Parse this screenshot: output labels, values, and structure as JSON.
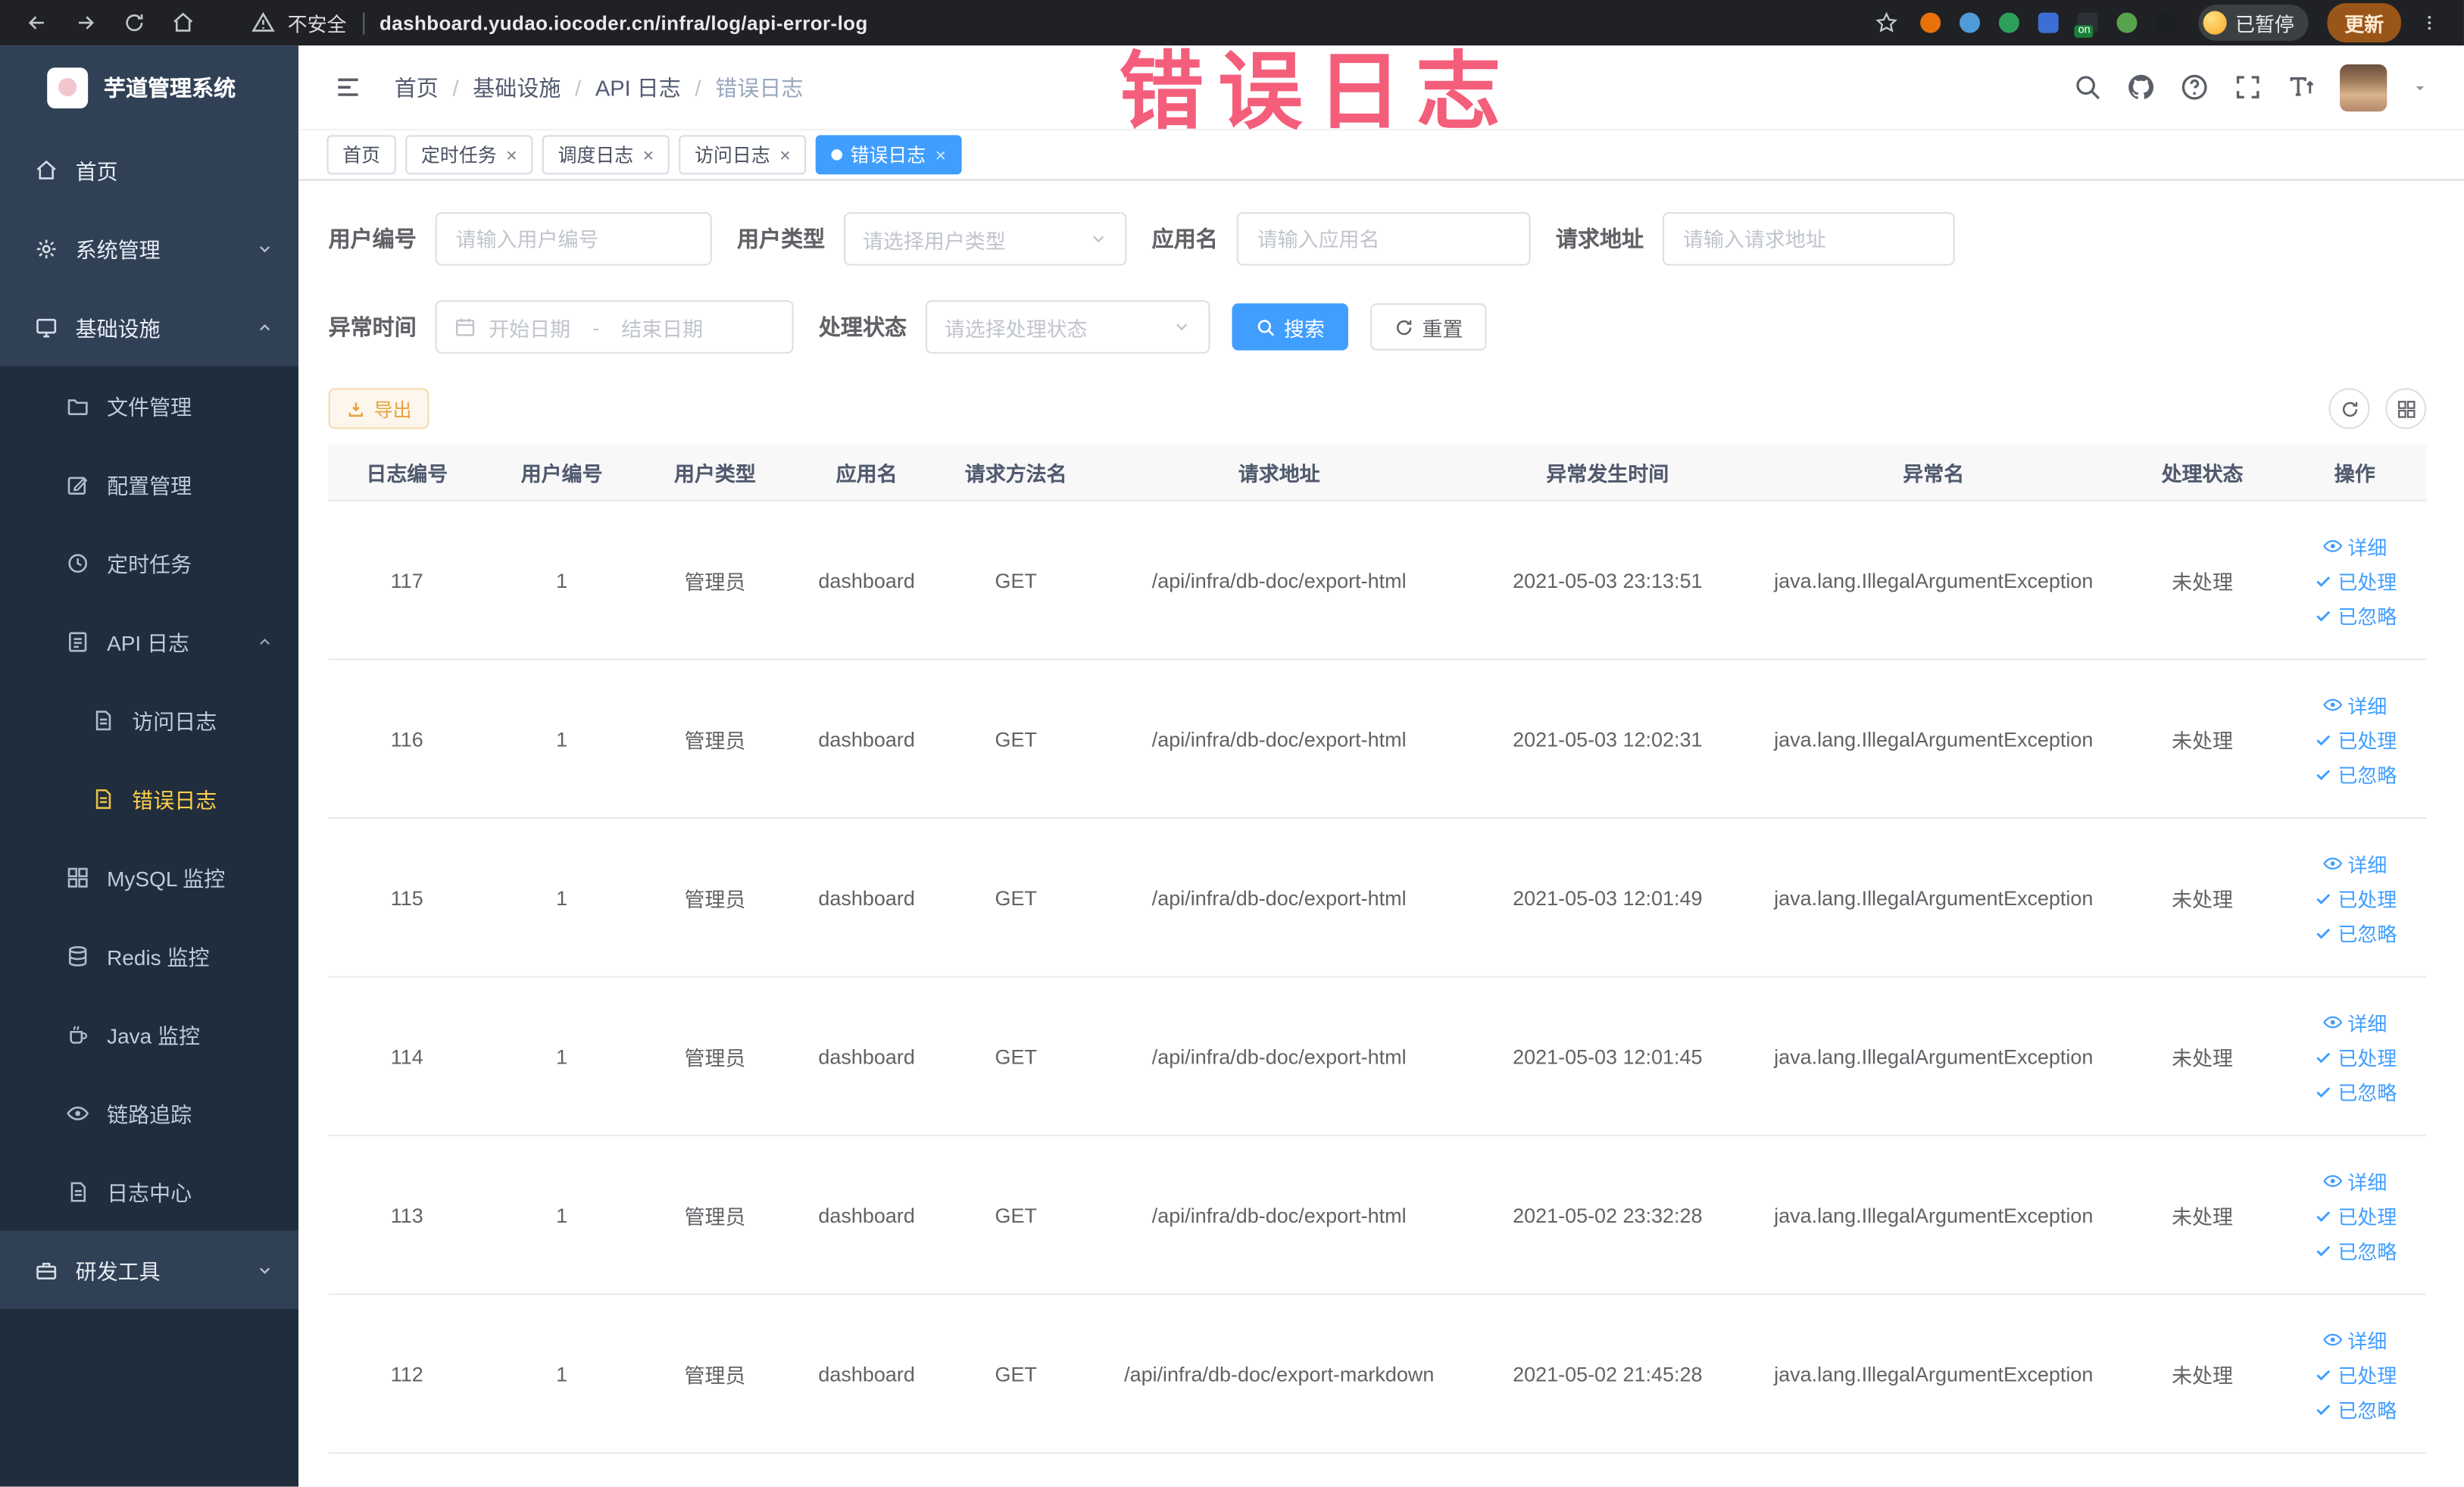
{
  "browser": {
    "security_label": "不安全",
    "url": "dashboard.yudao.iocoder.cn/infra/log/api-error-log",
    "profile_badge": "已暂停",
    "update_button": "更新",
    "extension_badge": "on"
  },
  "watermark": "错误日志",
  "sidebar": {
    "logo_title": "芋道管理系统",
    "home": "首页",
    "system": "系统管理",
    "infra": "基础设施",
    "file": "文件管理",
    "config": "配置管理",
    "job": "定时任务",
    "api_log": "API 日志",
    "access_log": "访问日志",
    "error_log": "错误日志",
    "mysql": "MySQL 监控",
    "redis": "Redis 监控",
    "java": "Java 监控",
    "trace": "链路追踪",
    "log_center": "日志中心",
    "dev_tools": "研发工具"
  },
  "breadcrumb": {
    "separator": "/",
    "items": [
      "首页",
      "基础设施",
      "API 日志",
      "错误日志"
    ]
  },
  "tabs": [
    {
      "label": "首页",
      "closable": false,
      "active": false
    },
    {
      "label": "定时任务",
      "closable": true,
      "active": false
    },
    {
      "label": "调度日志",
      "closable": true,
      "active": false
    },
    {
      "label": "访问日志",
      "closable": true,
      "active": false
    },
    {
      "label": "错误日志",
      "closable": true,
      "active": true
    }
  ],
  "filters": {
    "user_no": {
      "label": "用户编号",
      "placeholder": "请输入用户编号"
    },
    "user_type": {
      "label": "用户类型",
      "placeholder": "请选择用户类型"
    },
    "app_name": {
      "label": "应用名",
      "placeholder": "请输入应用名"
    },
    "req_url": {
      "label": "请求地址",
      "placeholder": "请输入请求地址"
    },
    "exc_time": {
      "label": "异常时间",
      "start": "开始日期",
      "sep": "-",
      "end": "结束日期"
    },
    "status": {
      "label": "处理状态",
      "placeholder": "请选择处理状态"
    },
    "search": "搜索",
    "reset": "重置"
  },
  "toolbar": {
    "export": "导出"
  },
  "table": {
    "columns": [
      "日志编号",
      "用户编号",
      "用户类型",
      "应用名",
      "请求方法名",
      "请求地址",
      "异常发生时间",
      "异常名",
      "处理状态",
      "操作"
    ],
    "actions": [
      "详细",
      "已处理",
      "已忽略"
    ],
    "rows": [
      {
        "id": "117",
        "user_id": "1",
        "user_type": "管理员",
        "app": "dashboard",
        "method": "GET",
        "url": "/api/infra/db-doc/export-html",
        "time": "2021-05-03 23:13:51",
        "exception": "java.lang.IllegalArgumentException",
        "status": "未处理"
      },
      {
        "id": "116",
        "user_id": "1",
        "user_type": "管理员",
        "app": "dashboard",
        "method": "GET",
        "url": "/api/infra/db-doc/export-html",
        "time": "2021-05-03 12:02:31",
        "exception": "java.lang.IllegalArgumentException",
        "status": "未处理"
      },
      {
        "id": "115",
        "user_id": "1",
        "user_type": "管理员",
        "app": "dashboard",
        "method": "GET",
        "url": "/api/infra/db-doc/export-html",
        "time": "2021-05-03 12:01:49",
        "exception": "java.lang.IllegalArgumentException",
        "status": "未处理"
      },
      {
        "id": "114",
        "user_id": "1",
        "user_type": "管理员",
        "app": "dashboard",
        "method": "GET",
        "url": "/api/infra/db-doc/export-html",
        "time": "2021-05-03 12:01:45",
        "exception": "java.lang.IllegalArgumentException",
        "status": "未处理"
      },
      {
        "id": "113",
        "user_id": "1",
        "user_type": "管理员",
        "app": "dashboard",
        "method": "GET",
        "url": "/api/infra/db-doc/export-html",
        "time": "2021-05-02 23:32:28",
        "exception": "java.lang.IllegalArgumentException",
        "status": "未处理"
      },
      {
        "id": "112",
        "user_id": "1",
        "user_type": "管理员",
        "app": "dashboard",
        "method": "GET",
        "url": "/api/infra/db-doc/export-markdown",
        "time": "2021-05-02 21:45:28",
        "exception": "java.lang.IllegalArgumentException",
        "status": "未处理"
      }
    ]
  }
}
